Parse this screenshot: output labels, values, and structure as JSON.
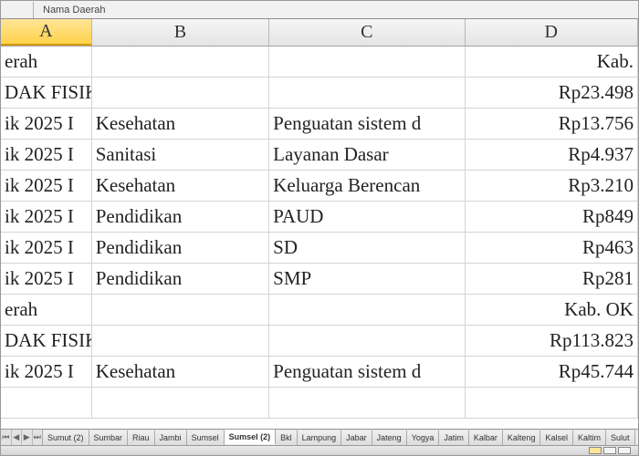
{
  "name_box": {
    "ref": "",
    "formula": "Nama Daerah"
  },
  "columns": [
    "A",
    "B",
    "C",
    "D"
  ],
  "selected_col_index": 0,
  "rows": [
    {
      "A": "erah",
      "B": "",
      "C": "",
      "D": "Kab. "
    },
    {
      "A": "DAK FISIK",
      "B": "",
      "C": "",
      "D": "Rp23.498"
    },
    {
      "A": "ik 2025 I",
      "B": "Kesehatan",
      "C": "Penguatan sistem d",
      "D": "Rp13.756"
    },
    {
      "A": "ik 2025 I",
      "B": "Sanitasi",
      "C": "Layanan Dasar",
      "D": "Rp4.937"
    },
    {
      "A": "ik 2025 I",
      "B": "Kesehatan",
      "C": "Keluarga Berencan",
      "D": "Rp3.210"
    },
    {
      "A": "ik 2025 I",
      "B": "Pendidikan",
      "C": "PAUD",
      "D": "Rp849"
    },
    {
      "A": "ik 2025 I",
      "B": "Pendidikan",
      "C": "SD",
      "D": "Rp463"
    },
    {
      "A": "ik 2025 I",
      "B": "Pendidikan",
      "C": "SMP",
      "D": "Rp281"
    },
    {
      "A": "erah",
      "B": "",
      "C": "",
      "D": "Kab. OK"
    },
    {
      "A": "DAK FISIK",
      "B": "",
      "C": "",
      "D": "Rp113.823"
    },
    {
      "A": "ik 2025 I",
      "B": "Kesehatan",
      "C": "Penguatan sistem d",
      "D": "Rp45.744"
    },
    {
      "A": "",
      "B": "",
      "C": "",
      "D": ""
    }
  ],
  "tabs": [
    "Sumut (2)",
    "Sumbar",
    "Riau",
    "Jambi",
    "Sumsel",
    "Sumsel (2)",
    "Bkl",
    "Lampung",
    "Jabar",
    "Jateng",
    "Yogya",
    "Jatim",
    "Kalbar",
    "Kalteng",
    "Kalsel",
    "Kaltim",
    "Sulut"
  ],
  "active_tab_index": 5
}
